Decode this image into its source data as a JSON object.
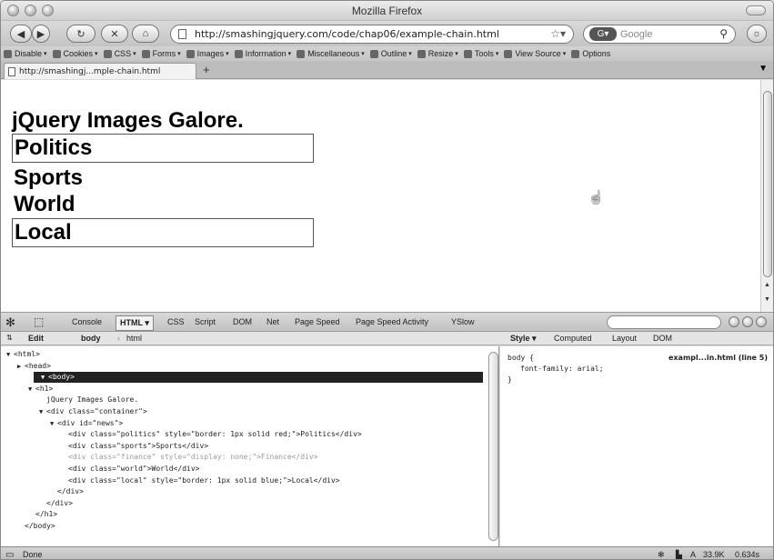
{
  "window": {
    "title": "Mozilla Firefox"
  },
  "nav": {
    "url": "http://smashingjquery.com/code/chap06/example-chain.html",
    "search_placeholder": "Google"
  },
  "devtoolbar": {
    "items": [
      "Disable",
      "Cookies",
      "CSS",
      "Forms",
      "Images",
      "Information",
      "Miscellaneous",
      "Outline",
      "Resize",
      "Tools",
      "View Source",
      "Options"
    ]
  },
  "tabs": [
    {
      "label": "http://smashingj...mple-chain.html"
    }
  ],
  "page": {
    "heading": "jQuery Images Galore.",
    "news": [
      {
        "label": "Politics",
        "bordered": true
      },
      {
        "label": "Sports",
        "bordered": false
      },
      {
        "label": "World",
        "bordered": false
      },
      {
        "label": "Local",
        "bordered": true
      }
    ]
  },
  "firebug": {
    "tabs": [
      "Console",
      "HTML",
      "CSS",
      "Script",
      "DOM",
      "Net",
      "Page Speed",
      "Page Speed Activity",
      "YSlow"
    ],
    "active_tab": "HTML",
    "edit_label": "Edit",
    "breadcrumb": [
      "body",
      "html"
    ],
    "side_tabs": [
      "Style",
      "Computed",
      "Layout",
      "DOM"
    ],
    "tree": [
      {
        "indent": 0,
        "toggle": "▼",
        "text": "<html>"
      },
      {
        "indent": 1,
        "toggle": "▶",
        "text": "<head>"
      },
      {
        "indent": 1,
        "toggle": "▼",
        "text": "<body>",
        "selected": true
      },
      {
        "indent": 2,
        "toggle": "▼",
        "text": "<h1>"
      },
      {
        "indent": 3,
        "toggle": "",
        "text": "jQuery Images Galore."
      },
      {
        "indent": 3,
        "toggle": "▼",
        "text": "<div class=\"container\">"
      },
      {
        "indent": 4,
        "toggle": "▼",
        "text": "<div id=\"news\">"
      },
      {
        "indent": 5,
        "toggle": "",
        "text": "<div class=\"politics\" style=\"border: 1px solid red;\">Politics</div>"
      },
      {
        "indent": 5,
        "toggle": "",
        "text": "<div class=\"sports\">Sports</div>"
      },
      {
        "indent": 5,
        "toggle": "",
        "text": "<div class=\"finance\" style=\"display: none;\">Finance</div>",
        "dim": true
      },
      {
        "indent": 5,
        "toggle": "",
        "text": "<div class=\"world\">World</div>"
      },
      {
        "indent": 5,
        "toggle": "",
        "text": "<div class=\"local\" style=\"border: 1px solid blue;\">Local</div>"
      },
      {
        "indent": 4,
        "toggle": "",
        "text": "</div>"
      },
      {
        "indent": 3,
        "toggle": "",
        "text": "</div>"
      },
      {
        "indent": 2,
        "toggle": "",
        "text": "</h1>"
      },
      {
        "indent": 1,
        "toggle": "",
        "text": "</body>"
      }
    ],
    "style_rule": {
      "selector": "body {",
      "declaration": "font-family: arial;",
      "close": "}",
      "source": "exampl...in.html (line 5)"
    }
  },
  "status": {
    "text": "Done",
    "size": "33.9K",
    "time": "0.634s",
    "a": "A"
  }
}
